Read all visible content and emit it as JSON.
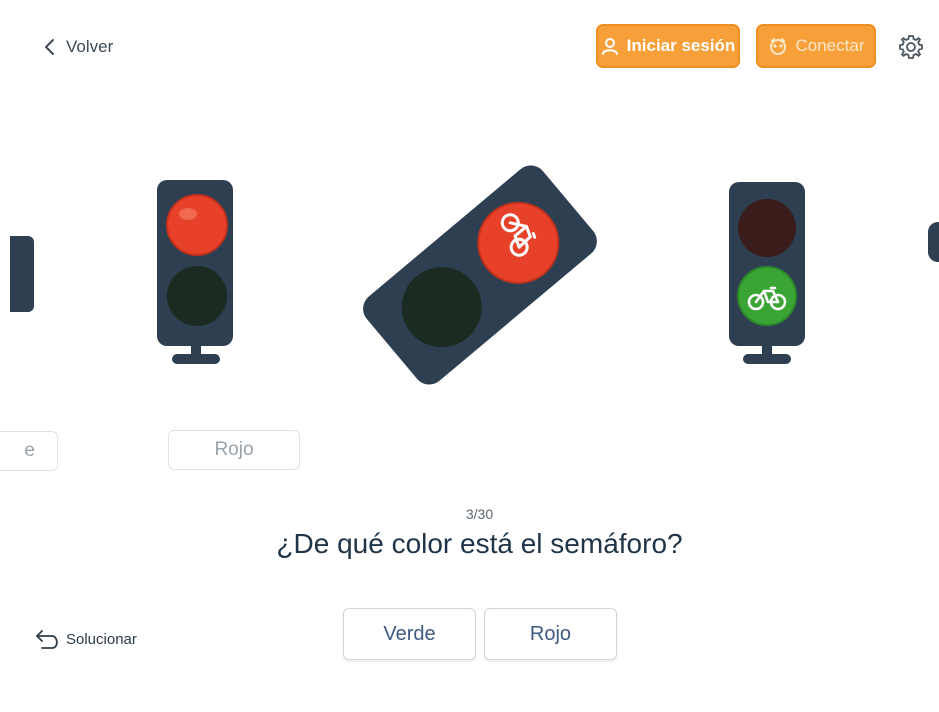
{
  "header": {
    "back_label": "Volver",
    "login_label": "Iniciar sesión",
    "connect_label": "Conectar"
  },
  "cards": {
    "left_edge_label": "e",
    "left_label": "Rojo"
  },
  "quiz": {
    "progress": "3/30",
    "question": "¿De qué color está el semáforo?",
    "answers": [
      "Verde",
      "Rojo"
    ],
    "solve_label": "Solucionar"
  },
  "colors": {
    "accent_orange": "#f7a03a",
    "light_red": "#e8412a",
    "light_green": "#3aa535",
    "housing": "#2e3f52"
  },
  "icons": {
    "back": "chevron-left-icon",
    "login": "user-icon",
    "connect": "owl-icon",
    "settings": "gear-icon",
    "solve": "undo-arrow-icon",
    "bicycle": "bicycle-icon"
  }
}
